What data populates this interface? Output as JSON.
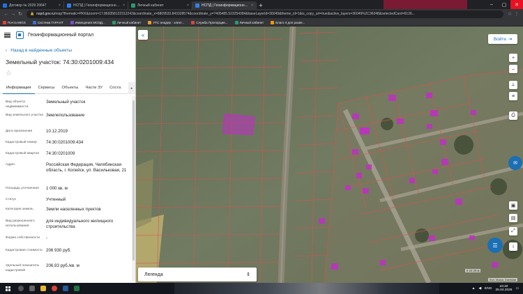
{
  "browser": {
    "tabs": [
      {
        "label": "Договор № 2029 20647",
        "color": "#1a73e8",
        "active": false
      },
      {
        "label": "НСПД | Геоинформационный п",
        "color": "#2f80ed",
        "active": false
      },
      {
        "label": "Личный кабинет",
        "color": "#2c9a6b",
        "active": false
      },
      {
        "label": "НСПД | Геоинформационный п",
        "color": "#2f80ed",
        "active": true
      }
    ],
    "close_glyph": "×",
    "new_tab_glyph": "+",
    "url_host": "nspd.gov.ru",
    "url_path": "/map?thematic=PKK&zoom=17.869358122312242&coordinate_x=6809533.843328574&coordinate_y=7405485.523254384&baseLayerId=36049&theme_id=1&is_copy_url=true&active_layers=36049%2C36048&selectedCard=6126...",
    "bookmarks": [
      {
        "label": "Почта MIGS",
        "color": "#e34133"
      },
      {
        "label": "Система ГАРАНТ",
        "color": "#3a6fd8"
      },
      {
        "label": "Извещения МОЭД...",
        "color": "#7a4fd0"
      },
      {
        "label": "Личный кабинет",
        "color": "#2c9a6b"
      },
      {
        "label": "УТС ннадер - элект...",
        "color": "#e8a020"
      },
      {
        "label": "Служба Пропорции...",
        "color": "#d9473b"
      },
      {
        "label": "Личный кабинет",
        "color": "#2c9a6b"
      },
      {
        "label": "Благо 4 доп разве...",
        "color": "#f29900"
      }
    ]
  },
  "portal": {
    "title": "Геоинформационный портал",
    "back_label": "Назад в найденные объекты",
    "object_title": "Земельный участок: 74:30:0201009:434",
    "tabs": [
      "Информация",
      "Сервисы",
      "Объекты",
      "Части ЗУ",
      "Соста"
    ],
    "tab_arrow": "▸",
    "fields": [
      {
        "label": "Вид объекта недвижимости",
        "value": "Земельный участок"
      },
      {
        "label": "Вид земельного участка",
        "value": "Землепользование"
      },
      {
        "label": "Дата присвоения",
        "value": "10.12.2019"
      },
      {
        "label": "Кадастровый номер",
        "value": "74:30:0201009:434"
      },
      {
        "label": "Кадастровый квартал",
        "value": "74:30:0201009"
      },
      {
        "label": "Адрес",
        "value": "Российская Федерация, Челябинская область, г. Копейск, ул. Васильковая, 21"
      },
      {
        "label": "Площадь уточненная",
        "value": "1 000 кв. м"
      },
      {
        "label": "Статус",
        "value": "Учтенный"
      },
      {
        "label": "Категория земель",
        "value": "Земли населенных пунктов"
      },
      {
        "label": "Вид разрешенного использования",
        "value": "для индивидуального жилищного строительства"
      },
      {
        "label": "Форма собственности",
        "value": "-"
      },
      {
        "label": "Кадастровая стоимость",
        "value": "206 930 руб."
      },
      {
        "label": "Удельный показатель кадастровой",
        "value": "206,93 руб./кв. м"
      }
    ]
  },
  "map": {
    "login_label": "Войти",
    "legend_label": "Легенда",
    "legend_arrows": "⇕",
    "collapse_glyph": "«",
    "scale_text": "0   10   20 м",
    "attribution": "Esri, Maxar, Earthstar",
    "parcel_color": "#c02fc4",
    "grid_color": "#d9534f",
    "chat_glyph": "☰"
  },
  "taskbar": {
    "time": "23:40",
    "date": "25.04.2025",
    "lang": "ENG"
  }
}
